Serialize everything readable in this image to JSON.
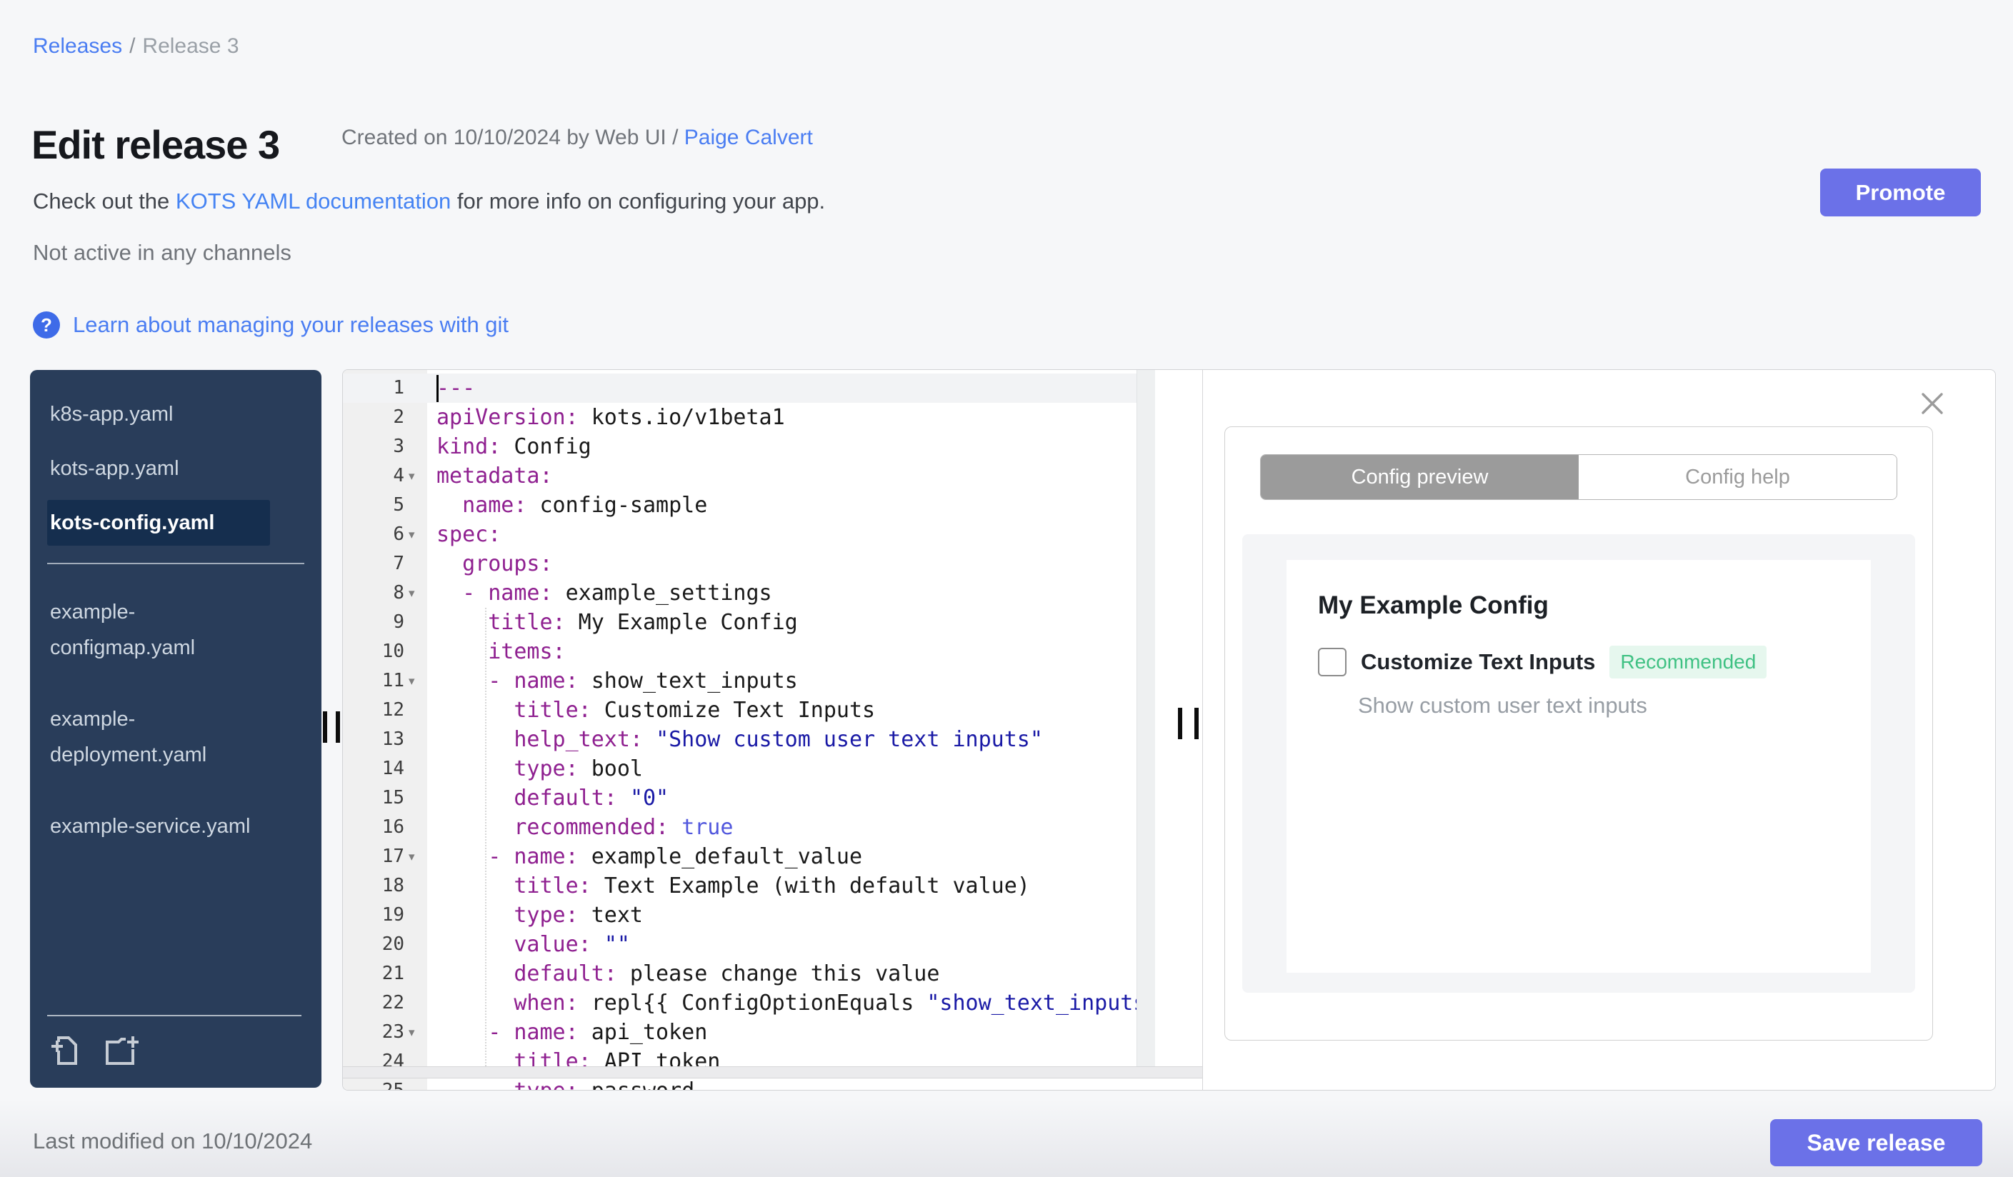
{
  "colors": {
    "accent_blue": "#4a7df2",
    "button_purple": "#6b71e8",
    "sidebar_bg": "#293d5a",
    "sidebar_selected_bg": "#152e4e",
    "tab_gray": "#9b9b9b",
    "badge_green": "#3fc183",
    "badge_green_bg": "#e6f7ee",
    "syntax_key": "#8f2090",
    "syntax_string": "#1a1aa6",
    "syntax_atom": "#5157dd"
  },
  "breadcrumb": {
    "link": "Releases",
    "separator": "/",
    "current": "Release 3"
  },
  "header": {
    "title": "Edit release 3",
    "created_prefix": "Created on 10/10/2024 by Web UI / ",
    "created_link": "Paige Calvert",
    "doc_before": "Check out the ",
    "doc_link": "KOTS YAML documentation",
    "doc_after": " for more info on configuring your app.",
    "channel_status": "Not active in any channels",
    "promote_label": "Promote",
    "help_icon": "?",
    "git_link": "Learn about managing your releases with git"
  },
  "sidebar": {
    "top_files": [
      {
        "label": "k8s-app.yaml",
        "selected": false
      },
      {
        "label": "kots-app.yaml",
        "selected": false
      },
      {
        "label": "kots-config.yaml",
        "selected": true
      }
    ],
    "bottom_files": [
      {
        "label": "example-configmap.yaml"
      },
      {
        "label": "example-deployment.yaml"
      },
      {
        "label": "example-service.yaml"
      }
    ],
    "icons": [
      "new-file-icon",
      "new-folder-icon"
    ]
  },
  "editor": {
    "active_line": 1,
    "lines": [
      {
        "n": 1,
        "fold": false,
        "segs": [
          [
            "k",
            "---"
          ]
        ]
      },
      {
        "n": 2,
        "fold": false,
        "segs": [
          [
            "k",
            "apiVersion:"
          ],
          [
            "t",
            " kots.io/v1beta1"
          ]
        ]
      },
      {
        "n": 3,
        "fold": false,
        "segs": [
          [
            "k",
            "kind:"
          ],
          [
            "t",
            " Config"
          ]
        ]
      },
      {
        "n": 4,
        "fold": true,
        "segs": [
          [
            "k",
            "metadata:"
          ]
        ]
      },
      {
        "n": 5,
        "fold": false,
        "segs": [
          [
            "t",
            "  "
          ],
          [
            "k",
            "name:"
          ],
          [
            "t",
            " config-sample"
          ]
        ]
      },
      {
        "n": 6,
        "fold": true,
        "segs": [
          [
            "k",
            "spec:"
          ]
        ]
      },
      {
        "n": 7,
        "fold": false,
        "segs": [
          [
            "t",
            "  "
          ],
          [
            "k",
            "groups:"
          ]
        ]
      },
      {
        "n": 8,
        "fold": true,
        "segs": [
          [
            "t",
            "  "
          ],
          [
            "k",
            "- name:"
          ],
          [
            "t",
            " example_settings"
          ]
        ]
      },
      {
        "n": 9,
        "fold": false,
        "segs": [
          [
            "t",
            "    "
          ],
          [
            "k",
            "title:"
          ],
          [
            "t",
            " My Example Config"
          ]
        ]
      },
      {
        "n": 10,
        "fold": false,
        "segs": [
          [
            "t",
            "    "
          ],
          [
            "k",
            "items:"
          ]
        ]
      },
      {
        "n": 11,
        "fold": true,
        "segs": [
          [
            "t",
            "    "
          ],
          [
            "k",
            "- name:"
          ],
          [
            "t",
            " show_text_inputs"
          ]
        ]
      },
      {
        "n": 12,
        "fold": false,
        "segs": [
          [
            "t",
            "      "
          ],
          [
            "k",
            "title:"
          ],
          [
            "t",
            " Customize Text Inputs"
          ]
        ]
      },
      {
        "n": 13,
        "fold": false,
        "segs": [
          [
            "t",
            "      "
          ],
          [
            "k",
            "help_text:"
          ],
          [
            "t",
            " "
          ],
          [
            "s",
            "\"Show custom user text inputs\""
          ]
        ]
      },
      {
        "n": 14,
        "fold": false,
        "segs": [
          [
            "t",
            "      "
          ],
          [
            "k",
            "type:"
          ],
          [
            "t",
            " bool"
          ]
        ]
      },
      {
        "n": 15,
        "fold": false,
        "segs": [
          [
            "t",
            "      "
          ],
          [
            "k",
            "default:"
          ],
          [
            "t",
            " "
          ],
          [
            "s",
            "\"0\""
          ]
        ]
      },
      {
        "n": 16,
        "fold": false,
        "segs": [
          [
            "t",
            "      "
          ],
          [
            "k",
            "recommended:"
          ],
          [
            "t",
            " "
          ],
          [
            "a",
            "true"
          ]
        ]
      },
      {
        "n": 17,
        "fold": true,
        "segs": [
          [
            "t",
            "    "
          ],
          [
            "k",
            "- name:"
          ],
          [
            "t",
            " example_default_value"
          ]
        ]
      },
      {
        "n": 18,
        "fold": false,
        "segs": [
          [
            "t",
            "      "
          ],
          [
            "k",
            "title:"
          ],
          [
            "t",
            " Text Example (with default value)"
          ]
        ]
      },
      {
        "n": 19,
        "fold": false,
        "segs": [
          [
            "t",
            "      "
          ],
          [
            "k",
            "type:"
          ],
          [
            "t",
            " text"
          ]
        ]
      },
      {
        "n": 20,
        "fold": false,
        "segs": [
          [
            "t",
            "      "
          ],
          [
            "k",
            "value:"
          ],
          [
            "t",
            " "
          ],
          [
            "s",
            "\"\""
          ]
        ]
      },
      {
        "n": 21,
        "fold": false,
        "segs": [
          [
            "t",
            "      "
          ],
          [
            "k",
            "default:"
          ],
          [
            "t",
            " please change this value"
          ]
        ]
      },
      {
        "n": 22,
        "fold": false,
        "segs": [
          [
            "t",
            "      "
          ],
          [
            "k",
            "when:"
          ],
          [
            "t",
            " repl{{ ConfigOptionEquals "
          ],
          [
            "s",
            "\"show_text_inputs\""
          ]
        ]
      },
      {
        "n": 23,
        "fold": true,
        "segs": [
          [
            "t",
            "    "
          ],
          [
            "k",
            "- name:"
          ],
          [
            "t",
            " api_token"
          ]
        ]
      },
      {
        "n": 24,
        "fold": false,
        "segs": [
          [
            "t",
            "      "
          ],
          [
            "k",
            "title:"
          ],
          [
            "t",
            " API token"
          ]
        ]
      },
      {
        "n": 25,
        "fold": false,
        "segs": [
          [
            "t",
            "      "
          ],
          [
            "k",
            "type:"
          ],
          [
            "t",
            " password"
          ]
        ]
      }
    ]
  },
  "preview": {
    "tabs": [
      {
        "label": "Config preview",
        "active": true
      },
      {
        "label": "Config help",
        "active": false
      }
    ],
    "card": {
      "heading": "My Example Config",
      "checkbox_checked": false,
      "checkbox_label": "Customize Text Inputs",
      "badge": "Recommended",
      "help_text": "Show custom user text inputs"
    }
  },
  "footer": {
    "last_modified": "Last modified on 10/10/2024",
    "save_label": "Save release"
  }
}
